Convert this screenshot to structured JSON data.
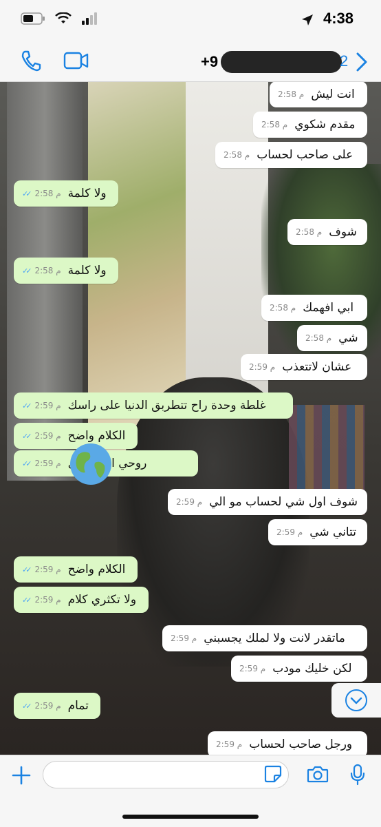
{
  "status_bar": {
    "time": "4:38"
  },
  "header": {
    "contact_prefix": "+9",
    "back_count": "2"
  },
  "messages": [
    {
      "text": "انت ليش",
      "time": "2:58 م",
      "side": "in"
    },
    {
      "text": "مقدم شكوي",
      "time": "2:58 م",
      "side": "in"
    },
    {
      "text": "على صاحب لحساب",
      "time": "2:58 م",
      "side": "in"
    },
    {
      "text": "ولا كلمة",
      "time": "2:58 م",
      "side": "out"
    },
    {
      "text": "شوف",
      "time": "2:58 م",
      "side": "in"
    },
    {
      "text": "ولا كلمة",
      "time": "2:58 م",
      "side": "out"
    },
    {
      "text": "ابي افهمك",
      "time": "2:58 م",
      "side": "in"
    },
    {
      "text": "شي",
      "time": "2:58 م",
      "side": "in"
    },
    {
      "text": "عشان لاتتعذب",
      "time": "2:59 م",
      "side": "in"
    },
    {
      "text": "غلطة وحدة راح تتطربق الدنيا على راسك",
      "time": "2:59 م",
      "side": "out"
    },
    {
      "text": "الكلام واضح",
      "time": "2:59 م",
      "side": "out"
    },
    {
      "text": "روحي اعتذري ل",
      "time": "2:59 م",
      "side": "out"
    },
    {
      "text": "شوف اول شي لحساب مو الي",
      "time": "2:59 م",
      "side": "in"
    },
    {
      "text": "تتاني شي",
      "time": "2:59 م",
      "side": "in"
    },
    {
      "text": "الكلام واضح",
      "time": "2:59 م",
      "side": "out"
    },
    {
      "text": "ولا تكثري كلام",
      "time": "2:59 م",
      "side": "out"
    },
    {
      "text": "ماتقدر لانت ولا لملك يجسبني",
      "time": "2:59 م",
      "side": "in"
    },
    {
      "text": "لكن خليك مودب",
      "time": "2:59 م",
      "side": "in"
    },
    {
      "text": "تمام",
      "time": "2:59 م",
      "side": "out"
    },
    {
      "text": "ورجل صاحب لحساب",
      "time": "2:59 م",
      "side": "in"
    }
  ],
  "composer": {
    "placeholder": ""
  },
  "icons": {
    "phone": "phone-icon",
    "video": "video-icon",
    "back": "chevron-right-icon",
    "globe": "globe-icon",
    "scroll": "chevron-down-circle-icon",
    "plus": "plus-icon",
    "sticker": "sticker-icon",
    "camera": "camera-icon",
    "mic": "mic-icon"
  },
  "colors": {
    "accent": "#1a82e2",
    "outgoing_bubble": "#dcf8c6",
    "incoming_bubble": "#ffffff",
    "read_ticks": "#4fa6f5"
  }
}
